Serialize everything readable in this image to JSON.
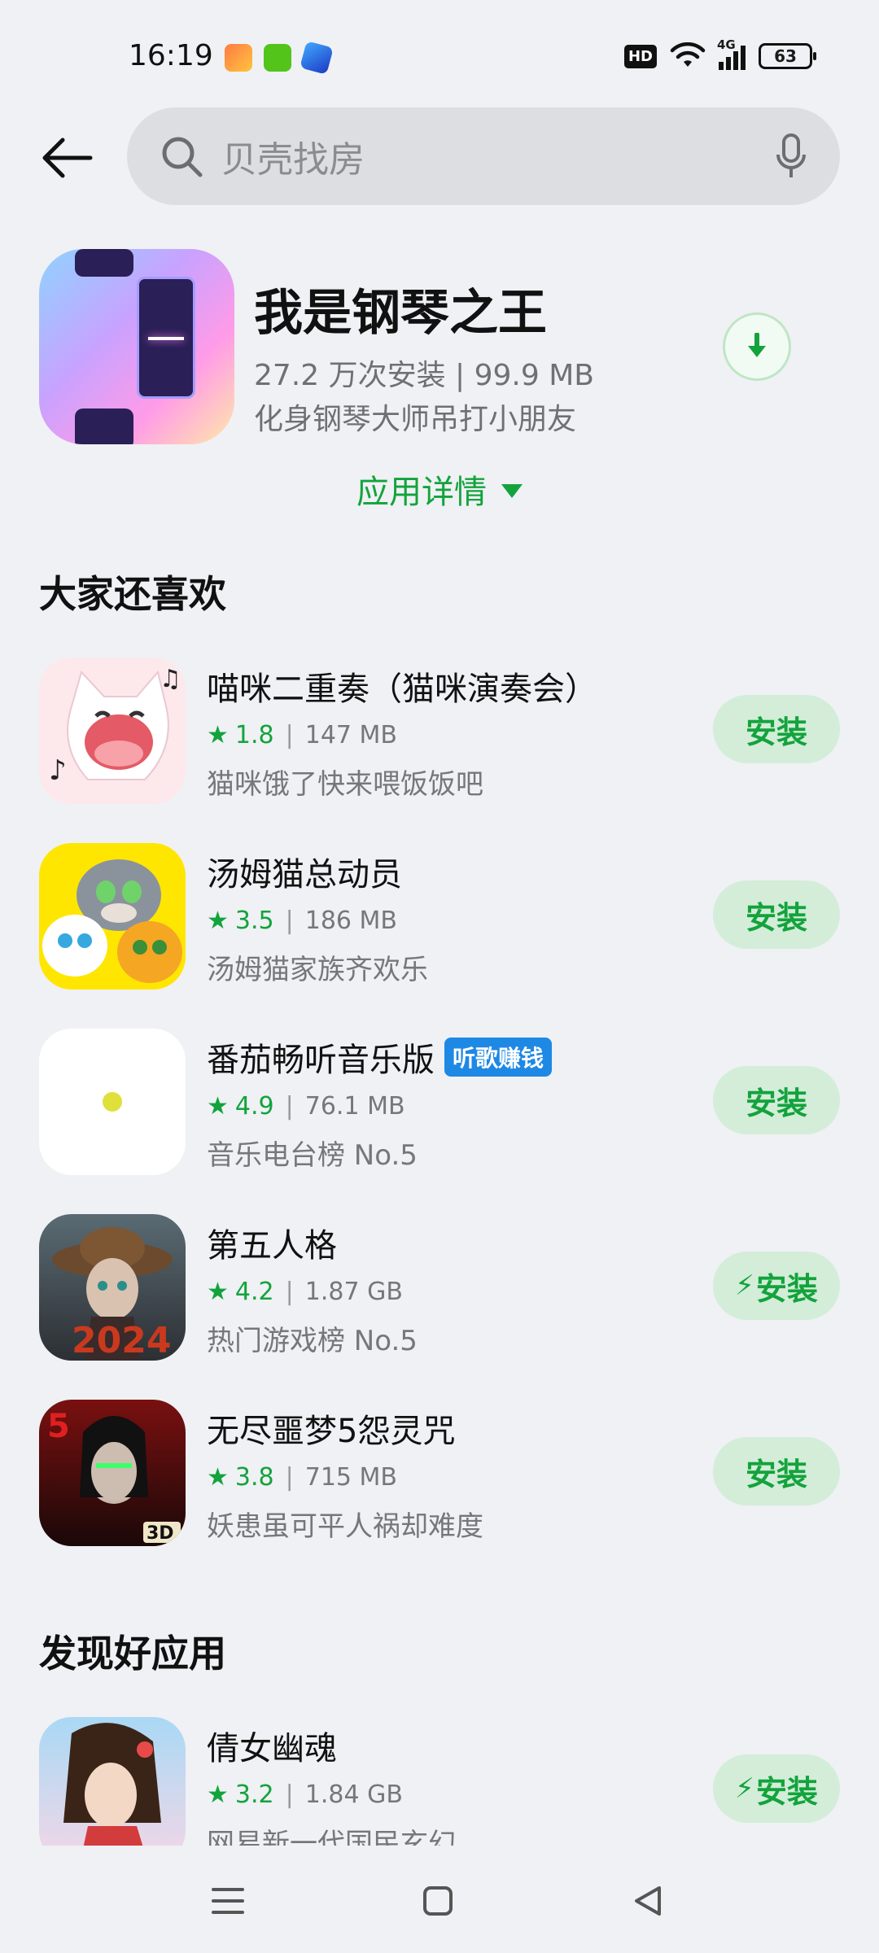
{
  "status": {
    "time": "16:19",
    "hd": "HD",
    "network": "4G",
    "battery": "63"
  },
  "search": {
    "placeholder": "贝壳找房"
  },
  "top_app": {
    "title": "我是钢琴之王",
    "meta": "27.2 万次安装 | 99.9 MB",
    "desc": "化身钢琴大师吊打小朋友",
    "details_label": "应用详情"
  },
  "section1": {
    "title": "大家还喜欢"
  },
  "section2": {
    "title": "发现好应用"
  },
  "apps": [
    {
      "name": "喵咪二重奏（猫咪演奏会）",
      "rating": "1.8",
      "size": "147 MB",
      "desc": "猫咪饿了快来喂饭饭吧",
      "button": "安装"
    },
    {
      "name": "汤姆猫总动员",
      "rating": "3.5",
      "size": "186 MB",
      "desc": "汤姆猫家族齐欢乐",
      "button": "安装"
    },
    {
      "name": "番茄畅听音乐版",
      "tag": "听歌赚钱",
      "rating": "4.9",
      "size": "76.1 MB",
      "desc": "音乐电台榜 No.5",
      "button": "安装"
    },
    {
      "name": "第五人格",
      "rating": "4.2",
      "size": "1.87 GB",
      "desc": "热门游戏榜 No.5",
      "button": "安装",
      "fast": true
    },
    {
      "name": "无尽噩梦5怨灵咒",
      "rating": "3.8",
      "size": "715 MB",
      "desc": "妖患虽可平人祸却难度",
      "button": "安装"
    }
  ],
  "discover": [
    {
      "name": "倩女幽魂",
      "rating": "3.2",
      "size": "1.84 GB",
      "desc": "网易新一代国民玄幻",
      "button": "安装",
      "fast": true
    }
  ],
  "colors": {
    "accent": "#13a33c",
    "install_bg": "#d3edd9",
    "tag_bg": "#1e88e5",
    "background": "#eff1f4"
  },
  "icons": [
    "back-arrow-icon",
    "search-icon",
    "mic-icon",
    "download-icon",
    "star-icon",
    "bolt-icon",
    "menu-icon",
    "home-icon",
    "back-triangle-icon"
  ]
}
